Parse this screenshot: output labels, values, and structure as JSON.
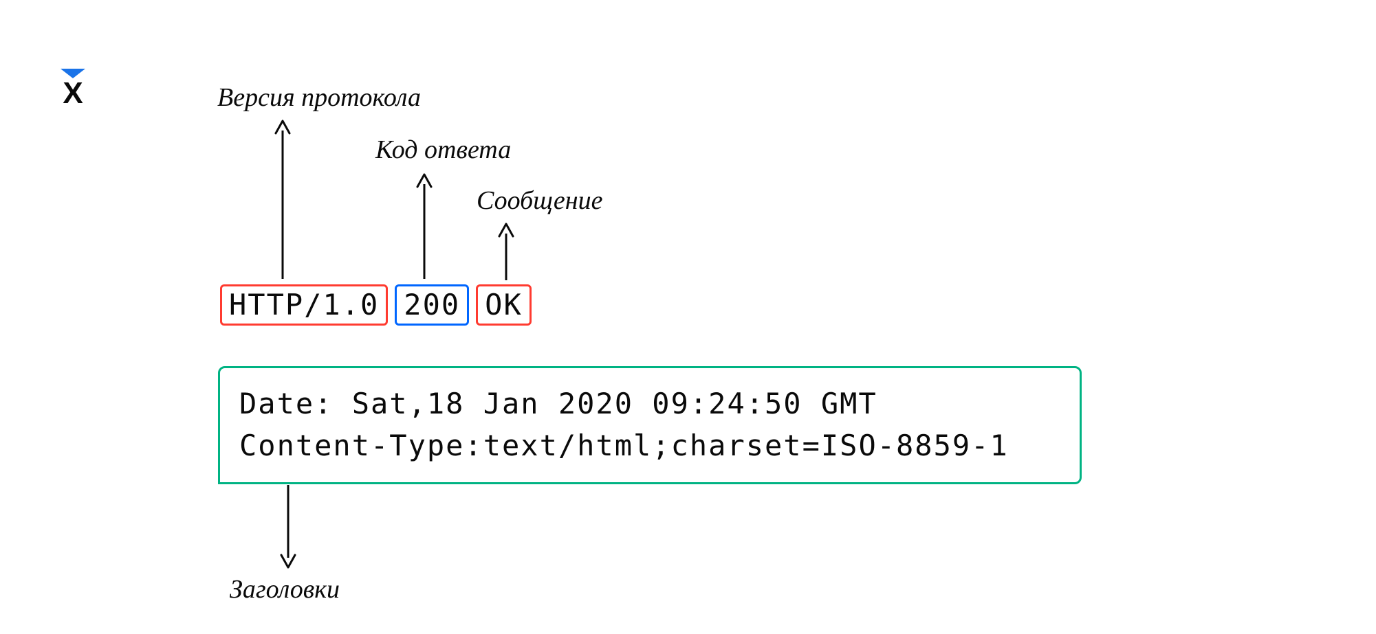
{
  "labels": {
    "protocol": "Версия протокола",
    "status_code": "Код ответа",
    "message": "Сообщение",
    "headers": "Заголовки"
  },
  "statusLine": {
    "protocol": "HTTP/1.0",
    "code": "200",
    "message": "OK"
  },
  "headers": {
    "line1": "Date: Sat,18 Jan 2020 09:24:50 GMT",
    "line2": "Content-Type:text/html;charset=ISO-8859-1"
  },
  "colors": {
    "red": "#ff3b30",
    "blue": "#0066ff",
    "green": "#00b383",
    "logoBlue": "#1a73e8"
  }
}
